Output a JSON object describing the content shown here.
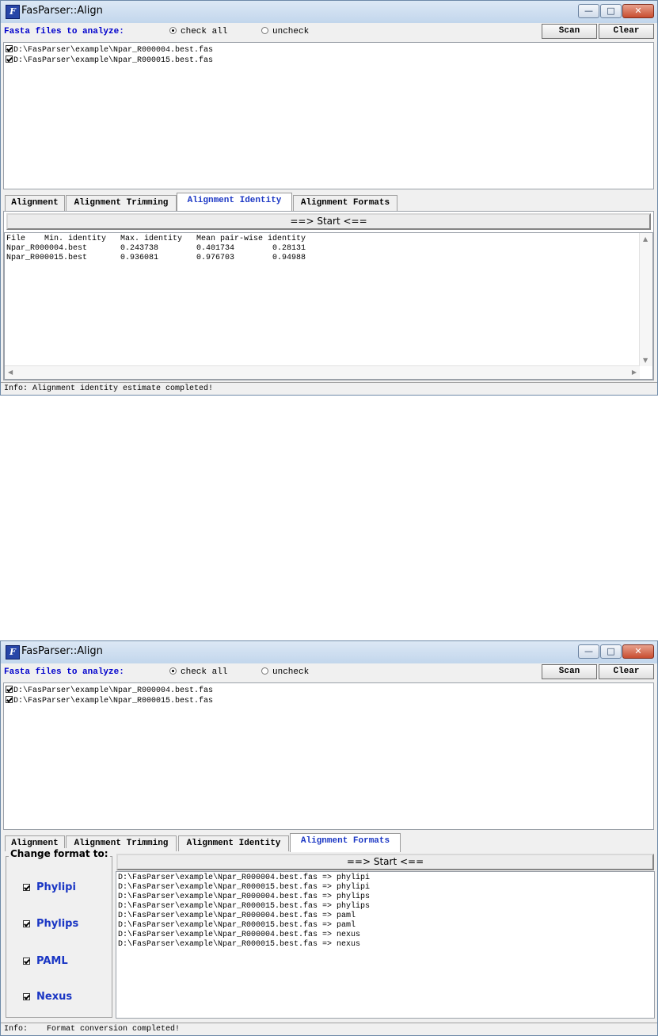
{
  "windows": [
    {
      "title": "FasParser::Align",
      "caption_buttons": {
        "minimize": "—",
        "maximize": "□",
        "close": "✕"
      },
      "prompt": "Fasta files to analyze:",
      "radio_check_all": "check all",
      "radio_uncheck": "uncheck",
      "btn_scan": "Scan",
      "btn_clear": "Clear",
      "files": [
        "D:\\FasParser\\example\\Npar_R000004.best.fas",
        "D:\\FasParser\\example\\Npar_R000015.best.fas"
      ],
      "tabs": [
        "Alignment",
        "Alignment Trimming",
        "Alignment Identity",
        "Alignment Formats"
      ],
      "active_tab": "Alignment Identity",
      "start_label": "==> Start <==",
      "output": [
        "File    Min. identity   Max. identity   Mean pair-wise identity",
        "Npar_R000004.best       0.243738        0.401734        0.28131",
        "Npar_R000015.best       0.936081        0.976703        0.94988"
      ],
      "status": "Info: Alignment identity estimate completed!"
    },
    {
      "title": "FasParser::Align",
      "caption_buttons": {
        "minimize": "—",
        "maximize": "□",
        "close": "✕"
      },
      "prompt": "Fasta files to analyze:",
      "radio_check_all": "check all",
      "radio_uncheck": "uncheck",
      "btn_scan": "Scan",
      "btn_clear": "Clear",
      "files": [
        "D:\\FasParser\\example\\Npar_R000004.best.fas",
        "D:\\FasParser\\example\\Npar_R000015.best.fas"
      ],
      "tabs": [
        "Alignment",
        "Alignment Trimming",
        "Alignment Identity",
        "Alignment Formats"
      ],
      "active_tab": "Alignment Formats",
      "group_title": "Change format to:",
      "formats": [
        "Phylipi",
        "Phylips",
        "PAML",
        "Nexus"
      ],
      "start_label": "==> Start <==",
      "output": [
        "D:\\FasParser\\example\\Npar_R000004.best.fas => phylipi",
        "D:\\FasParser\\example\\Npar_R000015.best.fas => phylipi",
        "D:\\FasParser\\example\\Npar_R000004.best.fas => phylips",
        "D:\\FasParser\\example\\Npar_R000015.best.fas => phylips",
        "D:\\FasParser\\example\\Npar_R000004.best.fas => paml",
        "D:\\FasParser\\example\\Npar_R000015.best.fas => paml",
        "D:\\FasParser\\example\\Npar_R000004.best.fas => nexus",
        "D:\\FasParser\\example\\Npar_R000015.best.fas => nexus"
      ],
      "status": "Info:    Format conversion completed!"
    }
  ]
}
